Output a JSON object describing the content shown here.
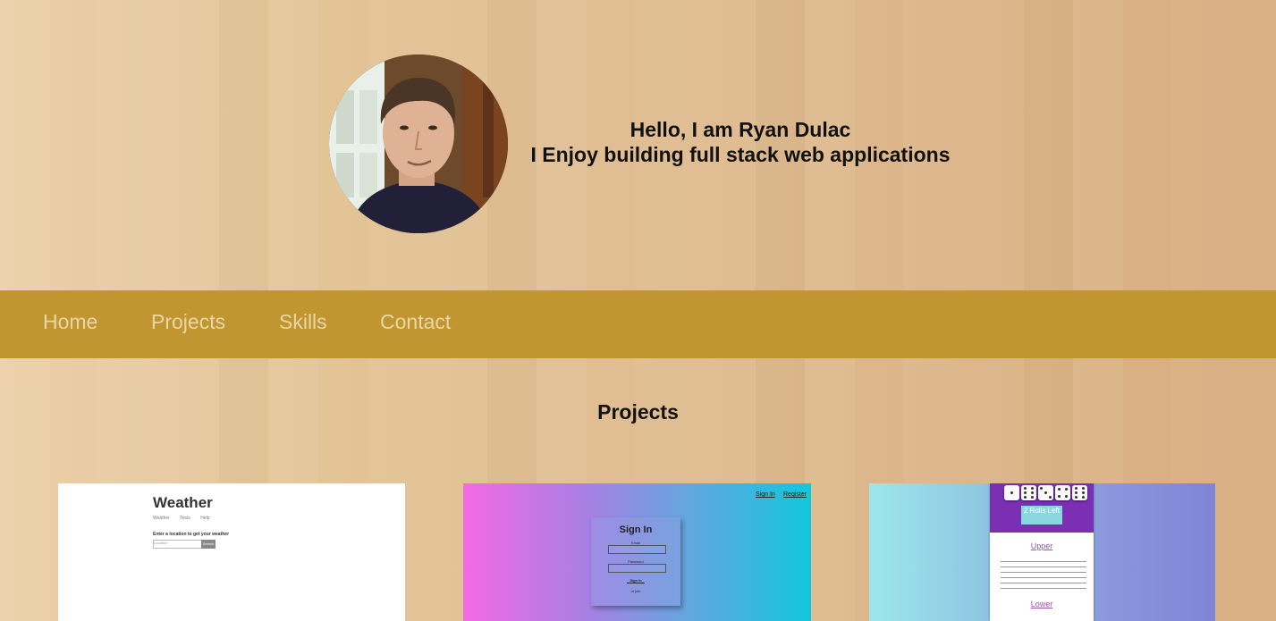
{
  "hero": {
    "greeting": "Hello, I am Ryan Dulac",
    "tagline": "I Enjoy building full stack web applications",
    "avatar_icon": "profile-photo"
  },
  "nav": {
    "items": [
      {
        "label": "Home"
      },
      {
        "label": "Projects"
      },
      {
        "label": "Skills"
      },
      {
        "label": "Contact"
      }
    ]
  },
  "projects": {
    "heading": "Projects",
    "weather_card": {
      "title": "Weather",
      "links": [
        "Weather",
        "Tests",
        "Help"
      ],
      "question": "Enter a location to get your weather",
      "input_placeholder": "Location",
      "button": "Search"
    },
    "signin_card": {
      "top_links": [
        "Sign In",
        "Register"
      ],
      "heading": "Sign In",
      "email_label": "Email",
      "password_label": "Password",
      "button": "Sign In",
      "register_text": "or join"
    },
    "yahtzee_card": {
      "roll_text": "2 Rolls Left",
      "upper_label": "Upper",
      "lower_label": "Lower"
    }
  },
  "colors": {
    "nav_bg": "#c19631",
    "nav_text": "#e9d6a6",
    "heading_text": "#111111"
  }
}
